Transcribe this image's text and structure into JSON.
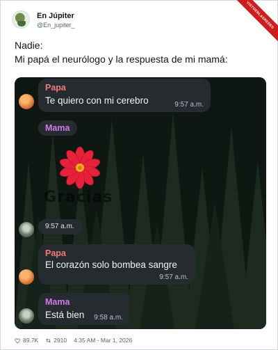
{
  "author": {
    "name": "En Júpiter",
    "handle": "@En_jupiter_"
  },
  "watermark_ribbon": "VISTOENLASREDES",
  "tweet": {
    "line1": "Nadie:",
    "line2": "Mi papá el neurólogo y la respuesta de mi mamá:"
  },
  "chat": {
    "messages": [
      {
        "sender": "Papa",
        "text": "Te quiero con mi cerebro",
        "time": "9:57 a.m."
      },
      {
        "sender": "Mama",
        "sticker_caption": "Gracias",
        "time": "9:57 a.m."
      },
      {
        "sender": "Papa",
        "text": "El corazón solo bombea sangre",
        "time": "9:57 a.m."
      },
      {
        "sender": "Mama",
        "text": "Está bien",
        "time": "9:58 a.m."
      }
    ]
  },
  "footer": {
    "likes": "89.7K",
    "retweets": "2910",
    "timestamp": "4:35 AM - Mar 1, 2026"
  },
  "colors": {
    "papa_name": "#f07a7a",
    "mama_name": "#d07be8",
    "bubble": "#262b30",
    "flower": "#e8213a"
  }
}
